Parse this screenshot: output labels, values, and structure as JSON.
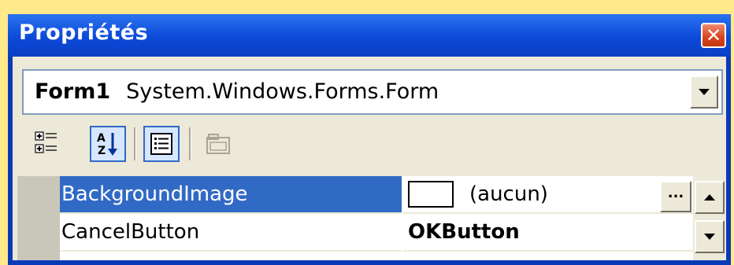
{
  "window": {
    "title": "Propriétés",
    "close_icon": "close-x-icon"
  },
  "object_selector": {
    "name": "Form1",
    "type": "System.Windows.Forms.Form",
    "dropdown_icon": "chevron-down-icon"
  },
  "toolbar": {
    "buttons": [
      {
        "icon": "categorized-icon",
        "checked": false
      },
      {
        "icon": "alphabetical-sort-icon",
        "checked": true
      },
      {
        "icon": "properties-icon",
        "checked": true
      },
      {
        "icon": "property-pages-icon",
        "enabled": false
      }
    ]
  },
  "properties": [
    {
      "name": "BackgroundImage",
      "value": "(aucun)",
      "selected": true,
      "has_swatch": true,
      "has_ellipsis": true
    },
    {
      "name": "CancelButton",
      "value": "OKButton",
      "selected": false,
      "bold": true
    }
  ],
  "ellipsis_label": "...",
  "colors": {
    "titlebar": "#0C4AD8",
    "selection": "#316AC5",
    "panel": "#ECE9D8",
    "background": "#FFE98A",
    "close": "#D9431E"
  }
}
